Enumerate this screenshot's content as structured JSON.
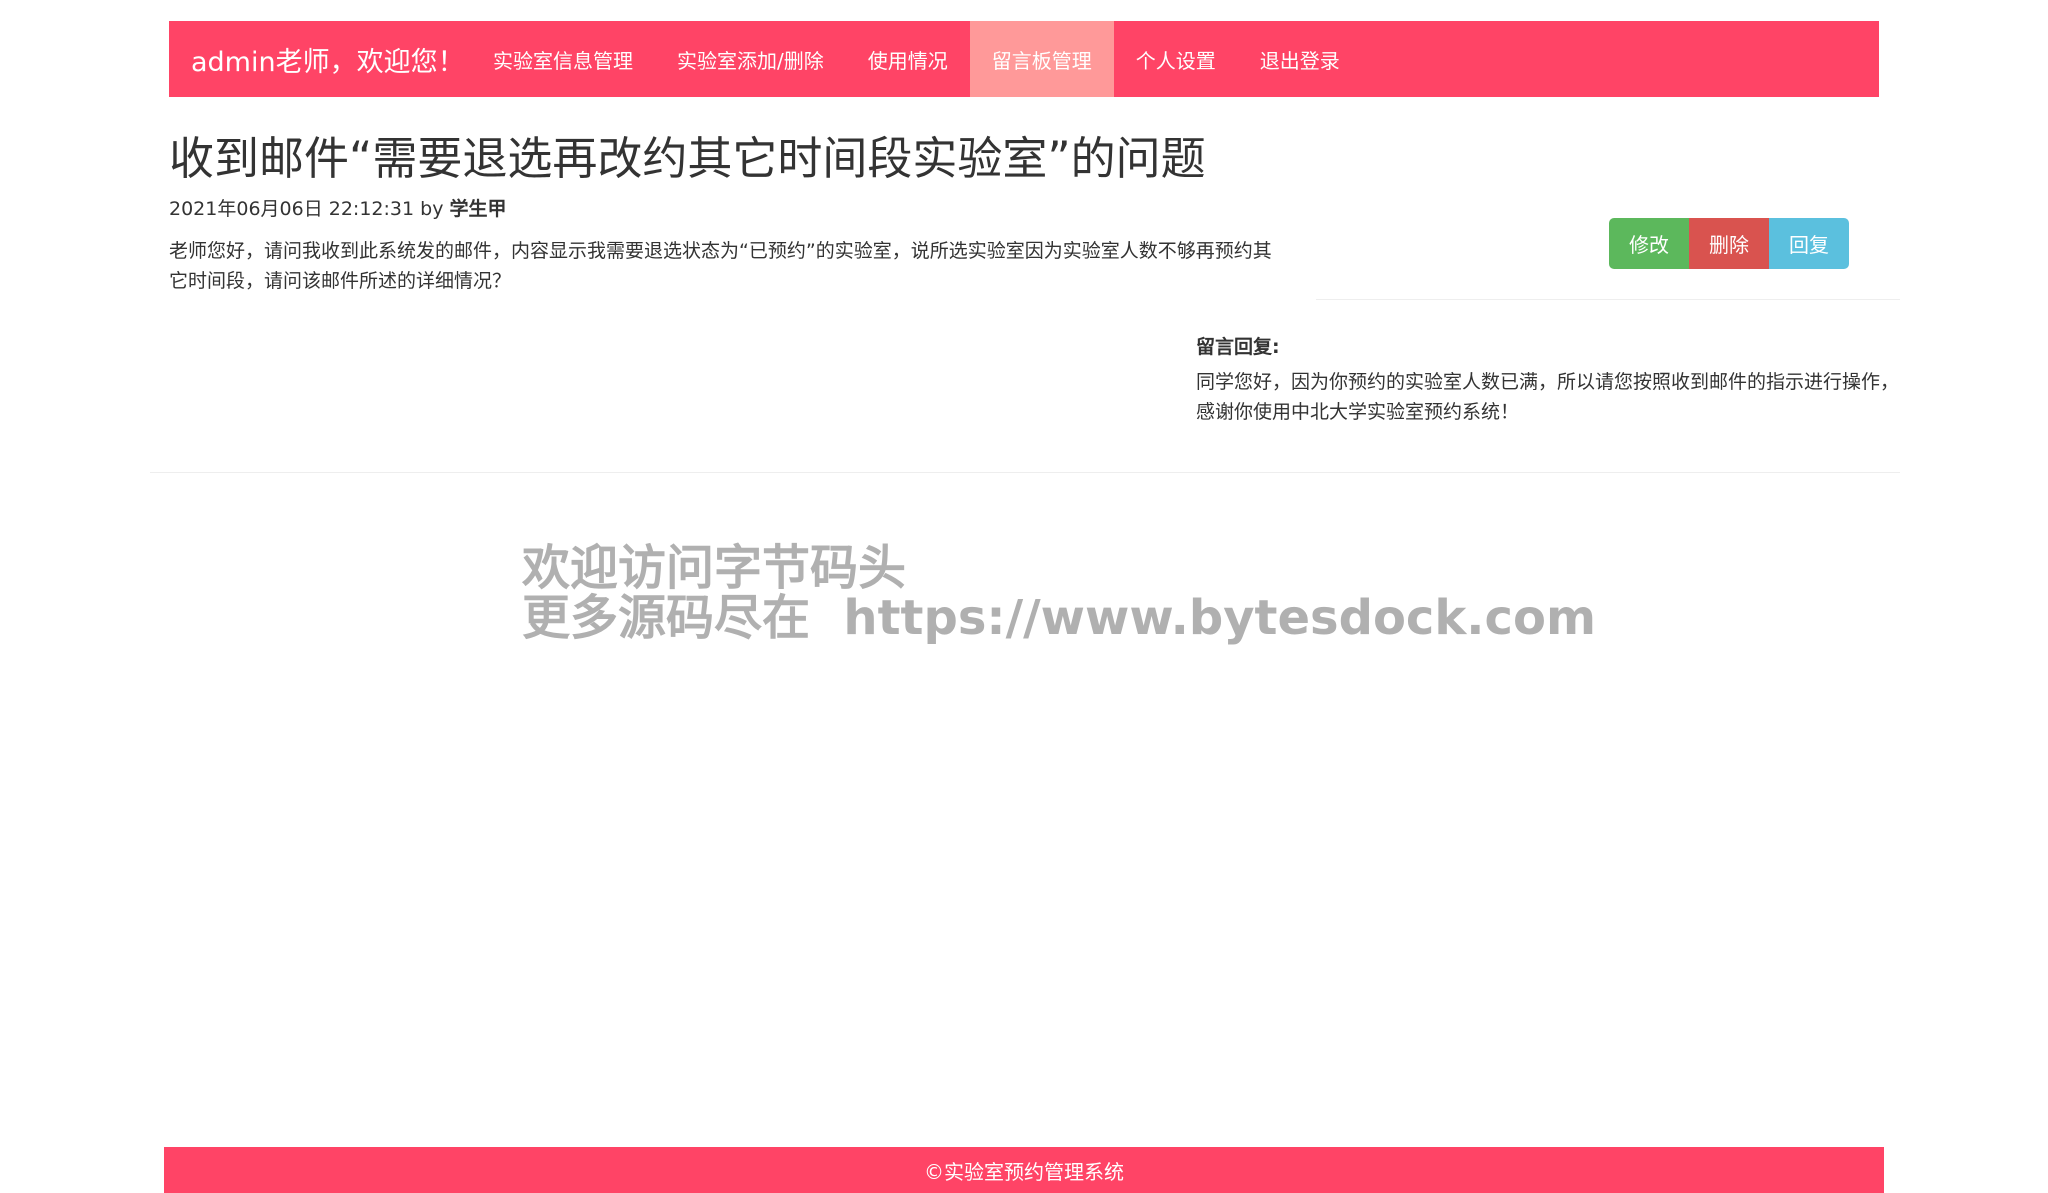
{
  "navbar": {
    "brand": "admin老师，欢迎您！",
    "items": [
      {
        "label": "实验室信息管理"
      },
      {
        "label": "实验室添加/删除"
      },
      {
        "label": "使用情况"
      },
      {
        "label": "留言板管理"
      },
      {
        "label": "个人设置"
      },
      {
        "label": "退出登录"
      }
    ],
    "active_index": 3
  },
  "message": {
    "title": "收到邮件“需要退选再改约其它时间段实验室”的问题",
    "datetime": "2021年06月06日 22:12:31",
    "by": "by",
    "author": "学生甲",
    "body": "老师您好，请问我收到此系统发的邮件，内容显示我需要退选状态为“已预约”的实验室，说所选实验室因为实验室人数不够再预约其它时间段，请问该邮件所述的详细情况？"
  },
  "actions": {
    "edit": "修改",
    "delete": "删除",
    "reply": "回复"
  },
  "reply": {
    "label": "留言回复:",
    "body": "同学您好，因为你预约的实验室人数已满，所以请您按照收到邮件的指示进行操作，感谢你使用中北大学实验室预约系统！"
  },
  "watermark": {
    "line1": "欢迎访问字节码头",
    "line2": "更多源码尽在  https://www.bytesdock.com"
  },
  "footer": {
    "text": "©实验室预约管理系统"
  },
  "colors": {
    "navbar_bg": "#ff4466",
    "nav_active_bg": "#ff9999",
    "btn_edit": "#5cb85c",
    "btn_delete": "#d9534f",
    "btn_reply": "#5bc0de"
  }
}
